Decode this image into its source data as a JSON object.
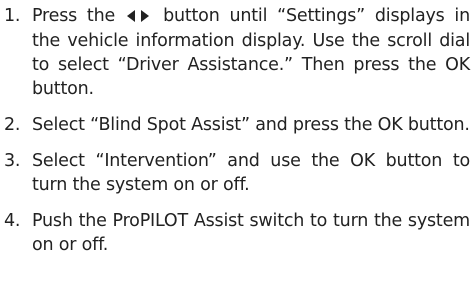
{
  "steps": [
    {
      "number": "1.",
      "before_icon": "Press the",
      "icon": "left-right-arrows-icon",
      "after_icon": "button until “Settings” displays in the vehicle information display. Use the scroll dial to select “Driver Assistance.” Then press the OK button."
    },
    {
      "number": "2.",
      "text": "Select “Blind Spot Assist” and press the OK button."
    },
    {
      "number": "3.",
      "text": "Select “Intervention” and use the OK button to turn the system on or off."
    },
    {
      "number": "4.",
      "text": "Push the ProPILOT Assist switch to turn the system on or off."
    }
  ]
}
